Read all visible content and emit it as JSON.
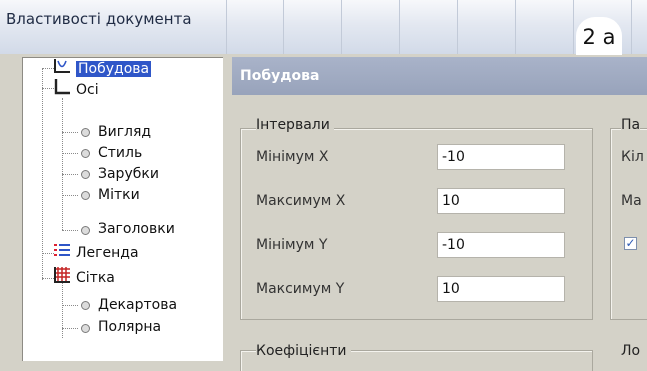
{
  "window": {
    "title": "Властивості документа",
    "badge": "2 а"
  },
  "tree": {
    "items": [
      {
        "label": "Побудова",
        "icon": "plot-axes-icon",
        "selected": true
      },
      {
        "label": "Осі",
        "icon": "axes-icon"
      },
      {
        "label": "Вигляд",
        "icon": "bullet-icon"
      },
      {
        "label": "Стиль",
        "icon": "bullet-icon"
      },
      {
        "label": "Зарубки",
        "icon": "bullet-icon"
      },
      {
        "label": "Мітки",
        "icon": "bullet-icon"
      },
      {
        "label": "Заголовки",
        "icon": "bullet-icon"
      },
      {
        "label": "Легенда",
        "icon": "legend-icon"
      },
      {
        "label": "Сітка",
        "icon": "grid-icon"
      },
      {
        "label": "Декартова",
        "icon": "bullet-icon"
      },
      {
        "label": "Полярна",
        "icon": "bullet-icon"
      }
    ]
  },
  "panel": {
    "header": "Побудова",
    "intervals": {
      "title": "Інтервали",
      "fields": [
        {
          "label": "Мінімум X",
          "value": "-10"
        },
        {
          "label": "Максимум X",
          "value": "10"
        },
        {
          "label": "Мінімум Y",
          "value": "-10"
        },
        {
          "label": "Максимум Y",
          "value": "10"
        }
      ]
    },
    "coefficients": {
      "title": "Коефіцієнти"
    },
    "right_cut": {
      "label_1": "Па",
      "label_2": "Кіл",
      "label_3": "Ма",
      "label_4": "Ло",
      "checkbox_checked": true
    }
  }
}
